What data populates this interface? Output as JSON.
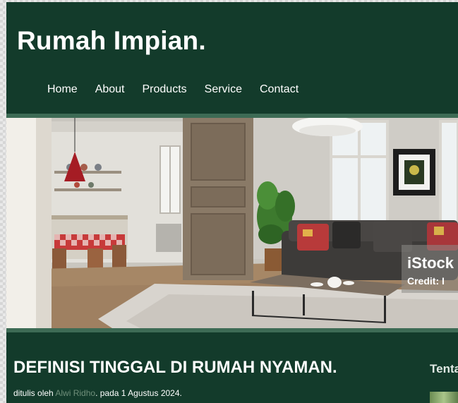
{
  "site": {
    "title": "Rumah Impian."
  },
  "nav": {
    "items": [
      {
        "label": "Home"
      },
      {
        "label": "About"
      },
      {
        "label": "Products"
      },
      {
        "label": "Service"
      },
      {
        "label": "Contact"
      }
    ]
  },
  "hero": {
    "watermark_brand": "iStock",
    "watermark_credit": "Credit: I"
  },
  "article": {
    "title": "DEFINISI TINGGAL DI RUMAH NYAMAN.",
    "meta_prefix": "ditulis oleh ",
    "author": "Alwi Ridho",
    "meta_suffix": ". pada 1 Agustus 2024."
  },
  "sidebar": {
    "title": "Tentang"
  },
  "colors": {
    "primary": "#133b2b",
    "accent": "#3d6b55",
    "author_link": "#6f8f7a"
  }
}
